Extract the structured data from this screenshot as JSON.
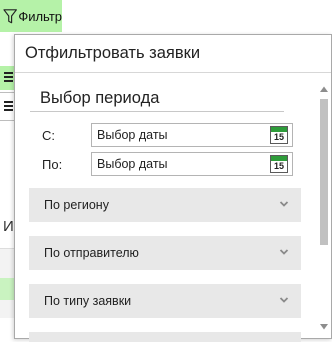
{
  "toolbar": {
    "filter_label": "Фильтр"
  },
  "background": {
    "partial_letter": "И"
  },
  "popup": {
    "title": "Отфильтровать заявки",
    "period_section": {
      "title": "Выбор периода",
      "from": {
        "label": "С:",
        "placeholder": "Выбор даты",
        "calendar_day": "15"
      },
      "to": {
        "label": "По:",
        "placeholder": "Выбор даты",
        "calendar_day": "15"
      }
    },
    "accordions": [
      {
        "label": "По региону"
      },
      {
        "label": "По отправителю"
      },
      {
        "label": "По типу заявки"
      }
    ]
  },
  "colors": {
    "accent_green": "#b5f2a8",
    "calendar_green": "#2e9c3a",
    "accordion_bg": "#e8e8e8"
  }
}
